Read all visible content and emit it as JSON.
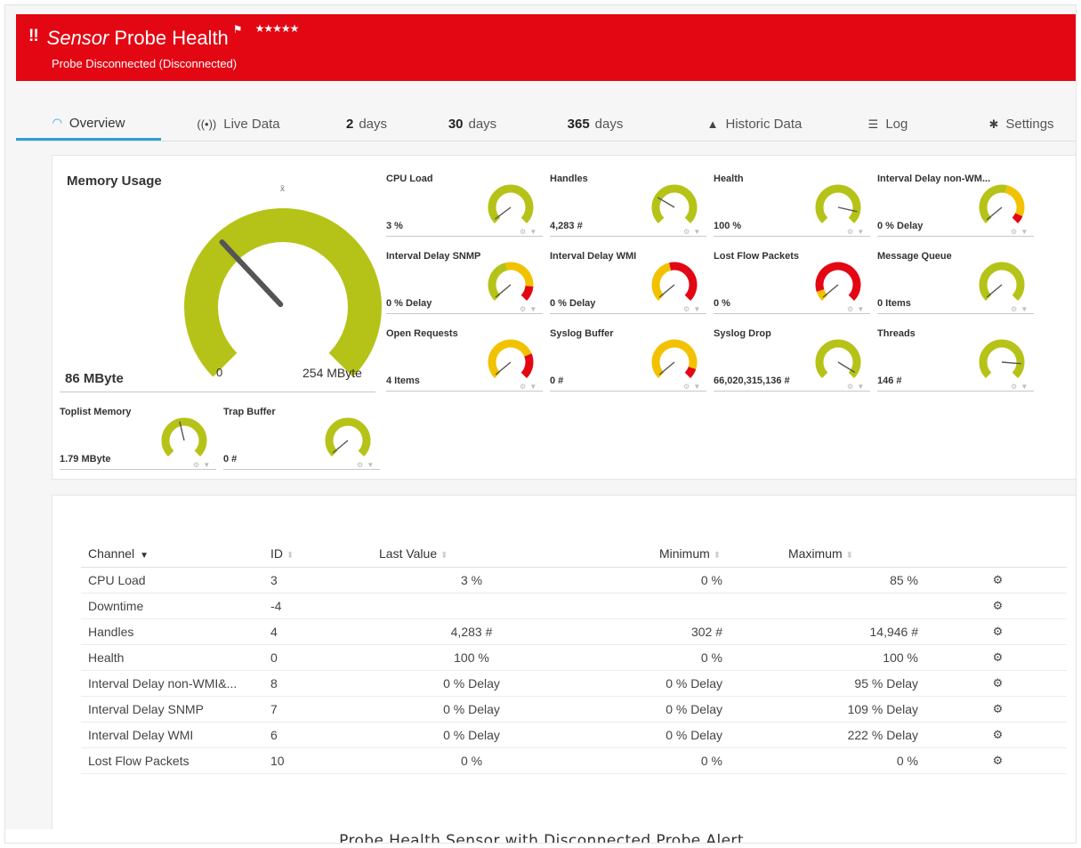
{
  "header": {
    "alert_icon": "!!",
    "title_type": "Sensor",
    "title_name": "Probe Health",
    "flag_icon": "flag-icon",
    "stars": "★★★★★",
    "status": "Probe Disconnected (Disconnected)",
    "background_color": "#e30613"
  },
  "tabs": [
    {
      "icon": "gauge-icon",
      "bold": "",
      "label": "Overview",
      "active": true
    },
    {
      "icon": "live-data-icon",
      "bold": "",
      "label": "Live Data"
    },
    {
      "icon": "",
      "bold": "2",
      "label": "days"
    },
    {
      "icon": "",
      "bold": "30",
      "label": "days"
    },
    {
      "icon": "",
      "bold": "365",
      "label": "days"
    },
    {
      "icon": "area-chart-icon",
      "bold": "",
      "label": "Historic Data"
    },
    {
      "icon": "list-icon",
      "bold": "",
      "label": "Log"
    },
    {
      "icon": "gear-icon",
      "bold": "",
      "label": "Settings"
    }
  ],
  "big_gauge": {
    "label": "Memory Usage",
    "value": "86 MByte",
    "min": "0",
    "max": "254 MByte",
    "avg_marker": "x̄",
    "fraction": 0.34
  },
  "gauges": [
    {
      "label": "CPU Load",
      "value": "3 %",
      "fraction": 0.03
    },
    {
      "label": "Handles",
      "value": "4,283 #",
      "fraction": 0.28
    },
    {
      "label": "Health",
      "value": "100 %",
      "fraction": 0.88
    },
    {
      "label": "Interval Delay non-WM...",
      "value": "0 % Delay",
      "fraction": 0.02
    },
    {
      "label": "Interval Delay SNMP",
      "value": "0 % Delay",
      "fraction": 0.02
    },
    {
      "label": "Interval Delay WMI",
      "value": "0 % Delay",
      "fraction": 0.02
    },
    {
      "label": "Lost Flow Packets",
      "value": "0 %",
      "fraction": 0.02
    },
    {
      "label": "Message Queue",
      "value": "0 Items",
      "fraction": 0.02
    },
    {
      "label": "Open Requests",
      "value": "4 Items",
      "fraction": 0.02
    },
    {
      "label": "Syslog Buffer",
      "value": "0 #",
      "fraction": 0.02
    },
    {
      "label": "Syslog Drop",
      "value": "66,020,315,136 #",
      "fraction": 0.95
    },
    {
      "label": "Threads",
      "value": "146 #",
      "fraction": 0.85
    },
    {
      "label": "Toplist Memory",
      "value": "1.79 MByte",
      "fraction": 0.45
    },
    {
      "label": "Trap Buffer",
      "value": "0 #",
      "fraction": 0.02
    }
  ],
  "table": {
    "headers": [
      "Channel",
      "ID",
      "Last Value",
      "Minimum",
      "Maximum"
    ],
    "rows": [
      [
        "CPU Load",
        "3",
        "3 %",
        "0 %",
        "85 %"
      ],
      [
        "Downtime",
        "-4",
        "",
        "",
        ""
      ],
      [
        "Handles",
        "4",
        "4,283 #",
        "302 #",
        "14,946 #"
      ],
      [
        "Health",
        "0",
        "100 %",
        "0 %",
        "100 %"
      ],
      [
        "Interval Delay non-WMI&...",
        "8",
        "0 % Delay",
        "0 % Delay",
        "95 % Delay"
      ],
      [
        "Interval Delay SNMP",
        "7",
        "0 % Delay",
        "0 % Delay",
        "109 % Delay"
      ],
      [
        "Interval Delay WMI",
        "6",
        "0 % Delay",
        "0 % Delay",
        "222 % Delay"
      ],
      [
        "Lost Flow Packets",
        "10",
        "0 %",
        "0 %",
        "0 %"
      ]
    ]
  },
  "caption": "Probe Health Sensor with Disconnected Probe Alert",
  "colors": {
    "accent": "#2e9fd6",
    "gauge_green": "#b5c318",
    "gauge_yellow": "#f2c200",
    "gauge_red": "#e30613"
  }
}
